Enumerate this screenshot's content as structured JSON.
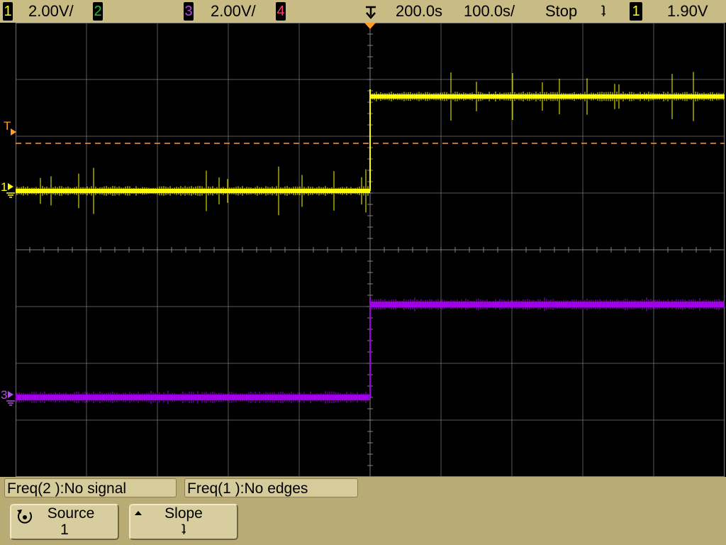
{
  "status_bar": {
    "ch1": {
      "number": "1",
      "scale": "2.00V/",
      "color": "#ffff00"
    },
    "ch2": {
      "number": "2",
      "color": "#22c32e"
    },
    "ch3": {
      "number": "3",
      "scale": "2.00V/",
      "color": "#b44ae6"
    },
    "ch4": {
      "number": "4",
      "color": "#ff3a6e"
    },
    "delay": "200.0s",
    "timebase": "100.0s/",
    "run_state": "Stop",
    "trigger_slope_symbol": "ʇ",
    "trigger_source": "1",
    "trigger_level": "1.90V"
  },
  "screen": {
    "trigger_marker": "T",
    "ch1_marker": "1",
    "ch3_marker": "3",
    "trace_colors": {
      "ch1": "#ffff00",
      "ch3": "#a000e8",
      "trigger_level_line": "#ff9b27",
      "grid": "#5a5a5a"
    }
  },
  "measurements": [
    {
      "label": "Freq(2 ):No signal"
    },
    {
      "label": "Freq(1 ):No edges"
    }
  ],
  "softkeys": {
    "source": {
      "label": "Source",
      "value": "1",
      "icon": "rotate-knob-icon"
    },
    "slope": {
      "label": "Slope",
      "value": "ʇ",
      "icon": "up-arrow-icon"
    }
  }
}
